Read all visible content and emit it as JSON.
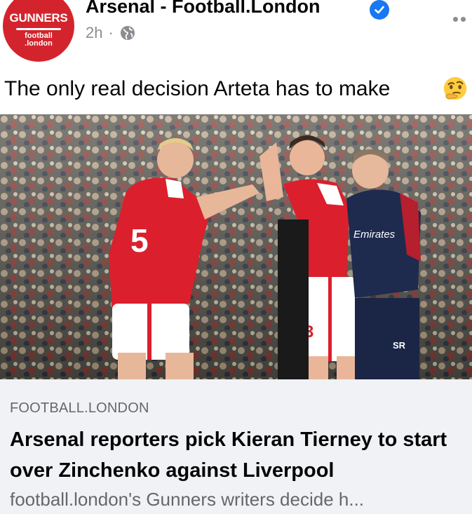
{
  "page": {
    "name": "Arsenal - Football.London",
    "time": "2h",
    "separator": "·",
    "audience_icon": "globe-icon",
    "verified_icon": "verified-badge-icon",
    "more_icon": "more-options-icon"
  },
  "avatar": {
    "brand": "GUNNERS",
    "sub_line1": "football",
    "sub_line2": ".london"
  },
  "post": {
    "text": "The only real decision Arteta has to make",
    "emoji": "thinking-face-icon"
  },
  "photo": {
    "player_left_number": "5",
    "player_right_number": "3",
    "sponsor": "Emirates",
    "staff_initials": "SR"
  },
  "link": {
    "source": "FOOTBALL.LONDON",
    "headline": "Arsenal reporters pick Kieran Tierney to start over Zinchenko against Liverpool",
    "description": "football.london's Gunners writers decide h..."
  },
  "colors": {
    "accent": "#1877f2",
    "arsenal_red": "#d3242e",
    "muted": "#65676b",
    "preview_bg": "#f0f2f5"
  }
}
